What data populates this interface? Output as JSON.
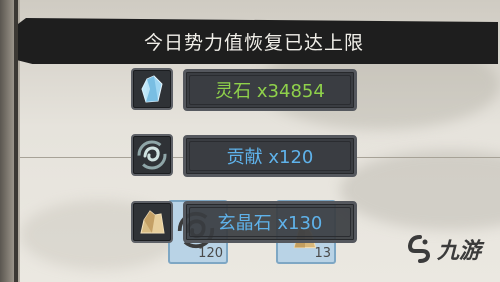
{
  "header": {
    "title": "今日势力值恢复已达上限"
  },
  "rewards": [
    {
      "label": "灵石 x34854",
      "icon": "spirit-stone-icon",
      "color": "#8fd14b"
    },
    {
      "label": "贡献 x120",
      "icon": "contribution-swirl-icon",
      "color": "#5fb2ea"
    },
    {
      "label": "玄晶石 x130",
      "icon": "crystal-ore-icon",
      "color": "#5fb2ea"
    }
  ],
  "slots": [
    {
      "count": "120",
      "icon": "contribution-swirl-icon"
    },
    {
      "count": "13",
      "icon": "crystal-ore-icon"
    }
  ],
  "watermark": {
    "text": "九游",
    "icon": "jiuyou-logo-icon"
  }
}
